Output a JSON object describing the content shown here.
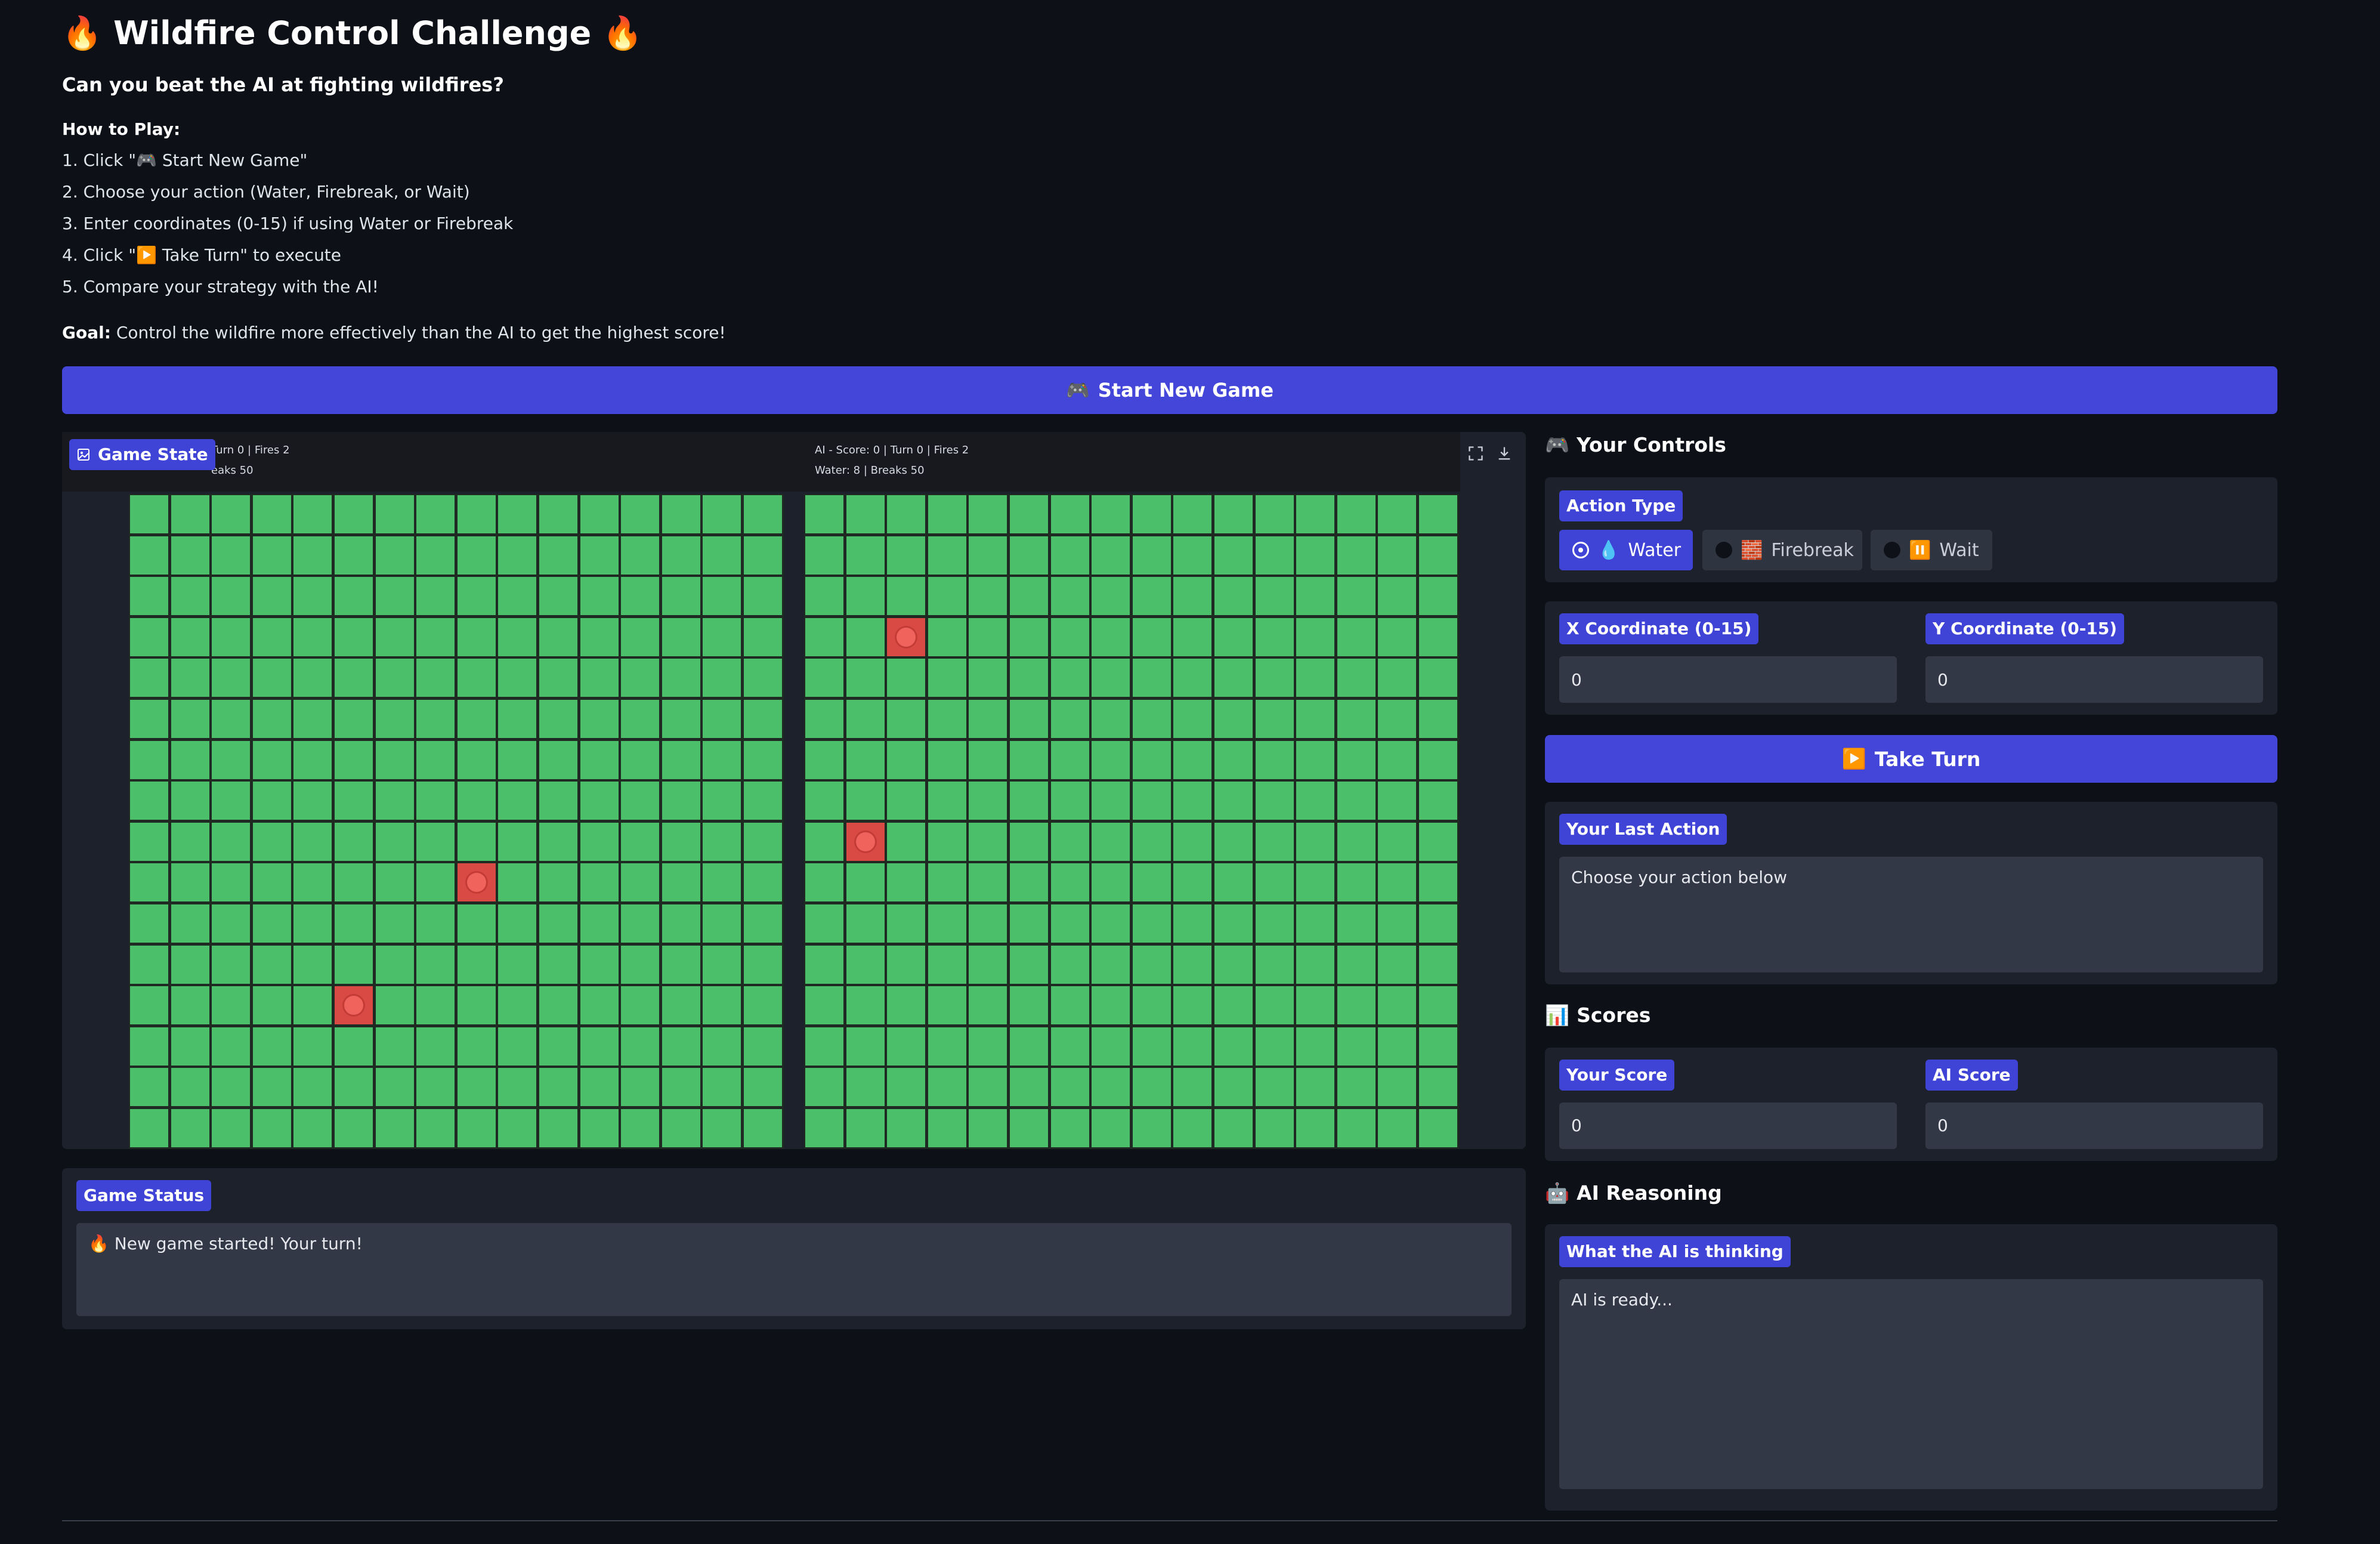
{
  "header": {
    "title": "Wildfire Control Challenge",
    "fire_emoji": "🔥",
    "subtitle": "Can you beat the AI at fighting wildfires?",
    "how_to_play_label": "How to Play:",
    "steps": [
      "1. Click \"🎮 Start New Game\"",
      "2. Choose your action (Water, Firebreak, or Wait)",
      "3. Enter coordinates (0-15) if using Water or Firebreak",
      "4. Click \"▶️ Take Turn\" to execute",
      "5. Compare your strategy with the AI!"
    ],
    "goal_label": "Goal:",
    "goal_text": " Control the wildfire more effectively than the AI to get the highest score!"
  },
  "start_button": {
    "icon": "🎮",
    "label": "Start New Game"
  },
  "game_state": {
    "label": "Game State",
    "player_hud_line1": "Turn 0 | Fires 2",
    "player_hud_line2": "eaks 50",
    "ai_hud_line1": "AI - Score: 0 | Turn 0 | Fires 2",
    "ai_hud_line2": "Water: 8 | Breaks 50",
    "grid_size": 16,
    "player_fires": [
      [
        8,
        9
      ],
      [
        5,
        12
      ]
    ],
    "ai_fires": [
      [
        2,
        3
      ],
      [
        1,
        8
      ]
    ]
  },
  "game_status": {
    "label": "Game Status",
    "value": "🔥 New game started! Your turn!"
  },
  "controls": {
    "heading_icon": "🎮",
    "heading": "Your Controls",
    "action_type_label": "Action Type",
    "actions": [
      {
        "icon": "💧",
        "label": "Water",
        "selected": true
      },
      {
        "icon": "🧱",
        "label": "Firebreak",
        "selected": false
      },
      {
        "icon": "⏸️",
        "label": "Wait",
        "selected": false
      }
    ],
    "x_label": "X Coordinate (0-15)",
    "x_value": "0",
    "y_label": "Y Coordinate (0-15)",
    "y_value": "0",
    "take_turn_icon": "▶️",
    "take_turn_label": "Take Turn",
    "last_action_label": "Your Last Action",
    "last_action_value": "Choose your action below"
  },
  "scores": {
    "heading_icon": "📊",
    "heading": "Scores",
    "your_score_label": "Your Score",
    "your_score_value": "0",
    "ai_score_label": "AI Score",
    "ai_score_value": "0"
  },
  "ai_reasoning": {
    "heading_icon": "🤖",
    "heading": "AI Reasoning",
    "thinking_label": "What the AI is thinking",
    "thinking_value": "AI is ready..."
  },
  "colors": {
    "accent": "#4044d6",
    "grass": "#4cbf6a",
    "fire": "#d94a45",
    "background": "#0d1117",
    "panel": "#1c212b"
  }
}
